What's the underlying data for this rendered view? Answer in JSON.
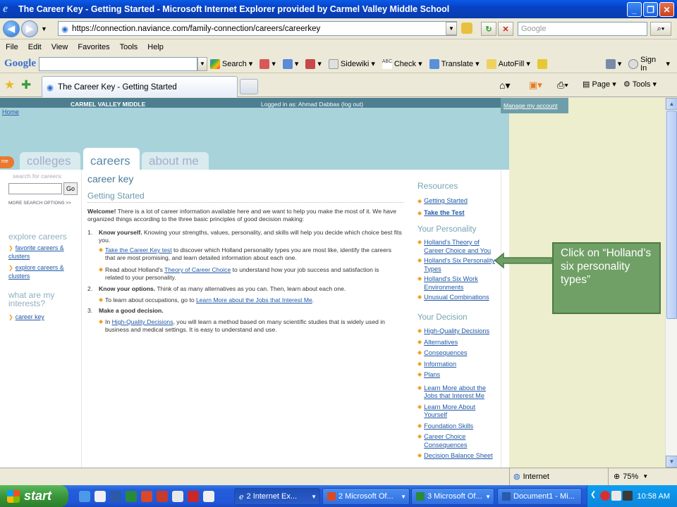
{
  "window": {
    "title": "The Career Key - Getting Started - Microsoft Internet Explorer provided by Carmel Valley Middle School",
    "minimize": "_",
    "maximize": "❐",
    "close": "✕"
  },
  "address": {
    "url": "https://connection.naviance.com/family-connection/careers/careerkey",
    "search_placeholder": "Google"
  },
  "menu": [
    "File",
    "Edit",
    "View",
    "Favorites",
    "Tools",
    "Help"
  ],
  "google_toolbar": {
    "logo": "Google",
    "items": [
      "Search",
      "Sidewiki",
      "Check",
      "Translate",
      "AutoFill"
    ],
    "sign_in": "Sign In"
  },
  "tabs": {
    "active": "The Career Key - Getting Started",
    "page": "Page",
    "tools": "Tools"
  },
  "page": {
    "school": "CARMEL VALLEY MIDDLE",
    "logged_in": "Logged in as: Ahmad Dabbas (log out)",
    "manage_account": "Manage my account",
    "home": "Home",
    "home_tab": "me",
    "nav_tabs": [
      "colleges",
      "careers",
      "about me"
    ],
    "search_label": "search for careers:",
    "go": "Go",
    "more_search": "MORE SEARCH OPTIONS >>",
    "explore_head": "explore careers",
    "explore_links": [
      "favorite careers & clusters",
      "explore careers & clusters"
    ],
    "interests_head": "what are my interests?",
    "interests_links": [
      "career key"
    ],
    "heading": "career key",
    "subheading": "Getting Started",
    "welcome_bold": "Welcome!",
    "welcome_text": " There is a lot of career information available here and we want to help you make the most of it. We have organized things according to the three basic principles of good decision making:",
    "s1_num": "1.",
    "s1_bold": "Know yourself.",
    "s1_text": " Knowing your strengths, values, personality, and skills will help you decide which choice best fits you.",
    "s1_b1_link": "Take the Career Key test",
    "s1_b1_text": " to discover which Holland personality types you are most like, identify the careers that are most promising, and learn detailed information about each one.",
    "s1_b2_pre": "Read about Holland's ",
    "s1_b2_link": "Theory of Career Choice",
    "s1_b2_text": " to understand how your job success and satisfaction is related to your personality.",
    "s2_num": "2.",
    "s2_bold": "Know your options.",
    "s2_text": " Think of as many alternatives as you can. Then, learn about each one.",
    "s2_b1_pre": "To learn about occupations, go to ",
    "s2_b1_link": "Learn More about the Jobs that Interest Me",
    "s2_b1_post": ".",
    "s3_num": "3.",
    "s3_bold": "Make a good decision.",
    "s3_b1_pre": "In ",
    "s3_b1_link": "High-Quality Decisions",
    "s3_b1_text": ", you will learn a method based on many scientific studies that is widely used in business and medical settings. It is easy to understand and use."
  },
  "resources": {
    "head": "Resources",
    "links": [
      "Getting Started",
      "Take the Test"
    ],
    "personality_head": "Your Personality",
    "personality_links": [
      "Holland's Theory of Career Choice and You",
      "Holland's Six Personality Types",
      "Holland's Six Work Environments",
      "Unusual Combinations"
    ],
    "decision_head": "Your Decision",
    "decision_links": [
      "High-Quality Decisions",
      "Alternatives",
      "Consequences",
      "Information",
      "Plans",
      "Learn More about the Jobs that Interest Me",
      "Learn More About Yourself",
      "Foundation Skills",
      "Career Choice Consequences",
      "Decision Balance Sheet"
    ]
  },
  "callout": {
    "text": "Click on “Holland’s six personality types”"
  },
  "status": {
    "zone": "Internet",
    "zoom": "75%"
  },
  "taskbar": {
    "start": "start",
    "buttons": [
      "2 Internet Ex...",
      "2 Microsoft Of...",
      "3 Microsoft Of...",
      "Document1 - Mi..."
    ],
    "clock": "10:58 AM"
  }
}
